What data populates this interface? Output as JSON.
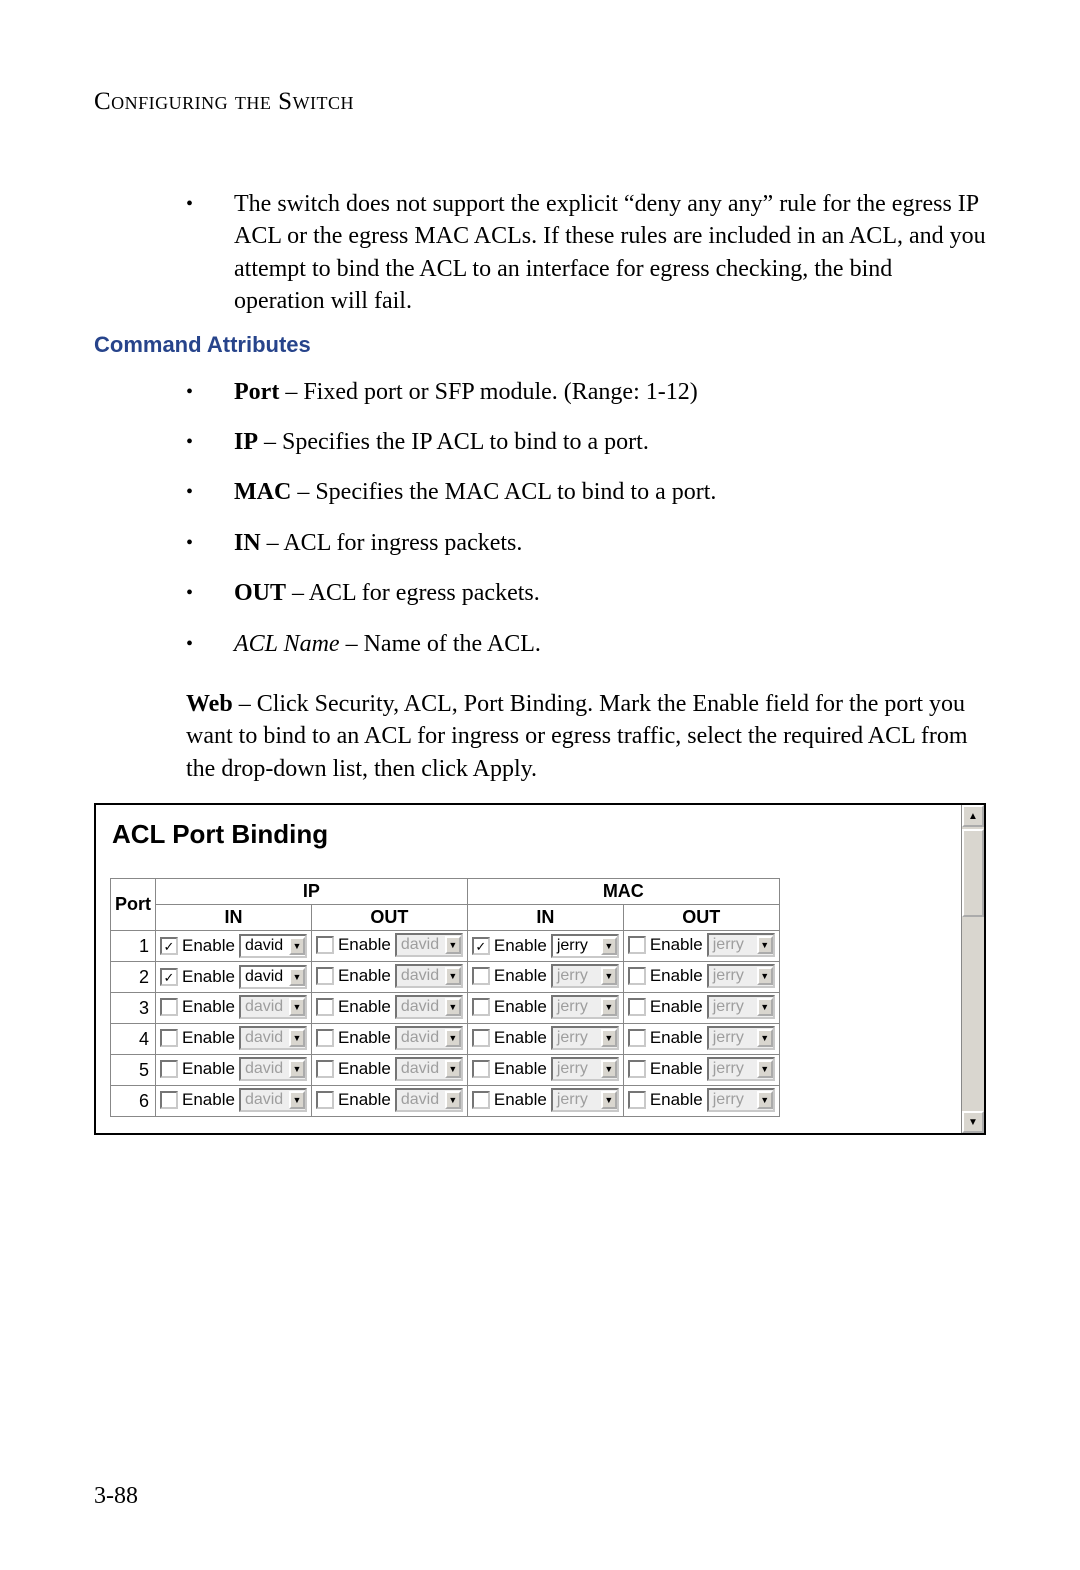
{
  "header": {
    "running_head": "Configuring the Switch"
  },
  "intro_bullet": "The switch does not support the explicit “deny any any” rule for the egress IP ACL or the egress MAC ACLs. If these rules are included in an ACL, and you attempt to bind the ACL to an interface for egress checking, the bind operation will fail.",
  "section_label": "Command Attributes",
  "attrs": [
    {
      "term": "Port",
      "desc": " – Fixed port or SFP module. (Range: 1-12)",
      "bold": true
    },
    {
      "term": "IP",
      "desc": " – Specifies the IP ACL to bind to a port.",
      "bold": true
    },
    {
      "term": "MAC",
      "desc": " – Specifies the MAC ACL to bind to a port.",
      "bold": true
    },
    {
      "term": "IN",
      "desc": " – ACL for ingress packets.",
      "bold": true
    },
    {
      "term": "OUT",
      "desc": " – ACL for egress packets.",
      "bold": true
    },
    {
      "term": "ACL Name",
      "desc": " – Name of the ACL.",
      "italic": true
    }
  ],
  "web_para_lead": "Web",
  "web_para_body": " – Click Security, ACL, Port Binding. Mark the Enable field for the port you want to bind to an ACL for ingress or egress traffic, select the required ACL from the drop-down list, then click Apply.",
  "shot": {
    "title": "ACL Port Binding",
    "col_port": "Port",
    "group_ip": "IP",
    "group_mac": "MAC",
    "sub_in": "IN",
    "sub_out": "OUT",
    "enable_label": "Enable",
    "ip_options": [
      "david"
    ],
    "mac_options": [
      "jerry"
    ],
    "rows": [
      {
        "port": "1",
        "ip_in": {
          "checked": true,
          "val": "david",
          "enabled": true
        },
        "ip_out": {
          "checked": false,
          "val": "david",
          "enabled": false
        },
        "mac_in": {
          "checked": true,
          "val": "jerry",
          "enabled": true
        },
        "mac_out": {
          "checked": false,
          "val": "jerry",
          "enabled": false
        }
      },
      {
        "port": "2",
        "ip_in": {
          "checked": true,
          "val": "david",
          "enabled": true
        },
        "ip_out": {
          "checked": false,
          "val": "david",
          "enabled": false
        },
        "mac_in": {
          "checked": false,
          "val": "jerry",
          "enabled": false
        },
        "mac_out": {
          "checked": false,
          "val": "jerry",
          "enabled": false
        }
      },
      {
        "port": "3",
        "ip_in": {
          "checked": false,
          "val": "david",
          "enabled": false
        },
        "ip_out": {
          "checked": false,
          "val": "david",
          "enabled": false
        },
        "mac_in": {
          "checked": false,
          "val": "jerry",
          "enabled": false
        },
        "mac_out": {
          "checked": false,
          "val": "jerry",
          "enabled": false
        }
      },
      {
        "port": "4",
        "ip_in": {
          "checked": false,
          "val": "david",
          "enabled": false
        },
        "ip_out": {
          "checked": false,
          "val": "david",
          "enabled": false
        },
        "mac_in": {
          "checked": false,
          "val": "jerry",
          "enabled": false
        },
        "mac_out": {
          "checked": false,
          "val": "jerry",
          "enabled": false
        }
      },
      {
        "port": "5",
        "ip_in": {
          "checked": false,
          "val": "david",
          "enabled": false
        },
        "ip_out": {
          "checked": false,
          "val": "david",
          "enabled": false
        },
        "mac_in": {
          "checked": false,
          "val": "jerry",
          "enabled": false
        },
        "mac_out": {
          "checked": false,
          "val": "jerry",
          "enabled": false
        }
      },
      {
        "port": "6",
        "ip_in": {
          "checked": false,
          "val": "david",
          "enabled": false
        },
        "ip_out": {
          "checked": false,
          "val": "david",
          "enabled": false
        },
        "mac_in": {
          "checked": false,
          "val": "jerry",
          "enabled": false
        },
        "mac_out": {
          "checked": false,
          "val": "jerry",
          "enabled": false
        }
      }
    ]
  },
  "page_number": "3-88"
}
